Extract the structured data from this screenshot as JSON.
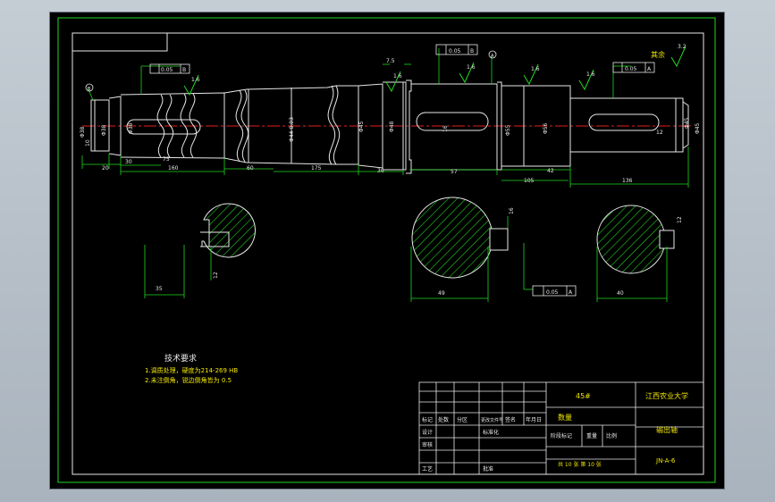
{
  "material": "45#",
  "school": "江西农业大学",
  "part_name": "输出轴",
  "drawing_no": "JN-A-6",
  "sheet_info": "共 10 张 第 10 张",
  "qty_label": "数量",
  "tech": {
    "title": "技术要求",
    "line1": "1.调质处理，硬度为214-269 HB",
    "line2": "2.未注倒角，锐边倒角皆为 0.5"
  },
  "title_block": {
    "revision_headers": [
      "标记",
      "处数",
      "分区",
      "更改文件号",
      "签名",
      "年月日"
    ],
    "row_labels": [
      "设计",
      "审核",
      "工艺"
    ],
    "mid_labels": [
      "标准化",
      "批准"
    ],
    "stage_label": "阶段标记",
    "weight_label": "重量",
    "scale_label": "比例"
  },
  "roughness": {
    "other_label": "其余",
    "other_value": "3.2",
    "value": "1.6"
  },
  "tolerances": {
    "runout_1": "0.05",
    "runout_1_ref": "B",
    "runout_2": "0.05",
    "runout_2_ref": "B",
    "runout_3": "0.05",
    "runout_3_ref": "A",
    "sym_1": "0.05",
    "sym_1_ref": "A",
    "datum_b_bubble": "B",
    "datum_a_bubble": "A"
  },
  "dims": {
    "d_end": "Φ38",
    "d_mid_left": "Φ38",
    "d_center": "Φ44-0.03",
    "d_45_left": "Φ45",
    "d_bearing": "Φ48",
    "d_gear": "Φ55",
    "d_shoulder": "Φ56",
    "d_right": "Φ45",
    "d_right2": "Φ45",
    "len_20": "20",
    "len_30": "30",
    "len_75": "75",
    "len_160": "160",
    "len_60": "60",
    "len_175": "175",
    "len_36": "36",
    "len_57": "57",
    "len_42": "42",
    "len_105": "105",
    "len_136": "136",
    "len_7_5": "7.5",
    "key_10": "10",
    "key_12": "12",
    "key_16": "16",
    "sec_left_w": "35",
    "sec_left_h": "12",
    "sec_mid_w": "49",
    "sec_mid_h": "16",
    "sec_right_w": "40",
    "sec_right_h": "12"
  }
}
